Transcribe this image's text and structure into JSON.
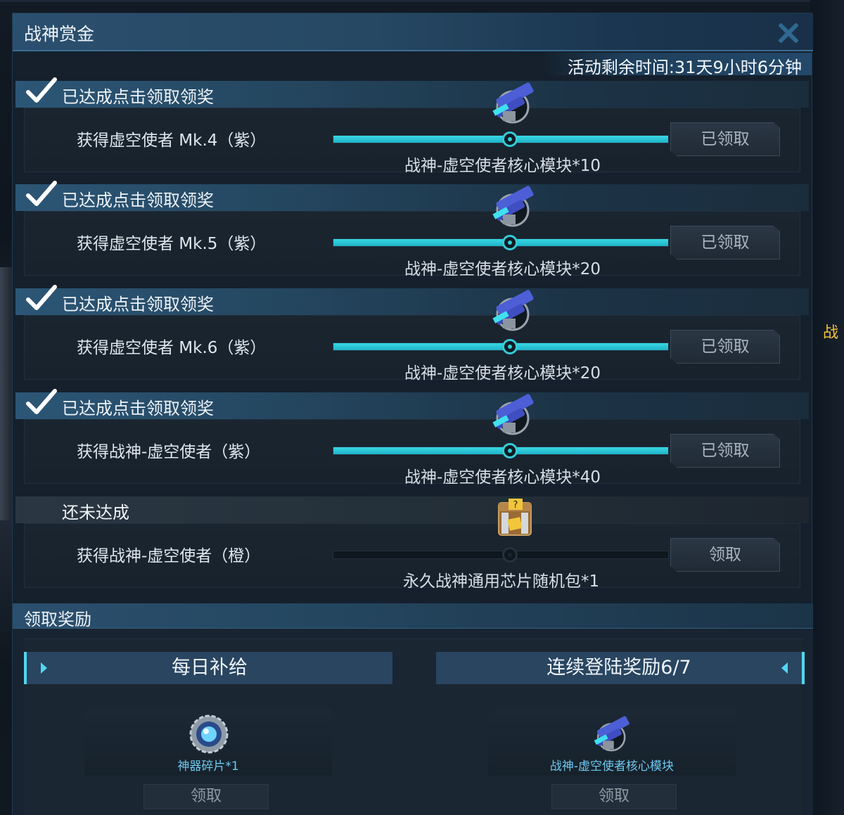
{
  "window": {
    "title": "战神赏金",
    "time_remaining": "活动剩余时间:31天9小时6分钟"
  },
  "rows": [
    {
      "status": "已达成点击领取领奖",
      "label": "获得虚空使者 Mk.4（紫）",
      "reward": "战神-虚空使者核心模块*10",
      "button": "已领取",
      "progress": 1.0,
      "achieved": true,
      "icon": "weapon-core-icon"
    },
    {
      "status": "已达成点击领取领奖",
      "label": "获得虚空使者 Mk.5（紫）",
      "reward": "战神-虚空使者核心模块*20",
      "button": "已领取",
      "progress": 1.0,
      "achieved": true,
      "icon": "weapon-core-icon"
    },
    {
      "status": "已达成点击领取领奖",
      "label": "获得虚空使者 Mk.6（紫）",
      "reward": "战神-虚空使者核心模块*20",
      "button": "已领取",
      "progress": 1.0,
      "achieved": true,
      "icon": "weapon-core-icon"
    },
    {
      "status": "已达成点击领取领奖",
      "label": "获得战神-虚空使者（紫）",
      "reward": "战神-虚空使者核心模块*40",
      "button": "已领取",
      "progress": 1.0,
      "achieved": true,
      "icon": "weapon-core-icon"
    },
    {
      "status": "还未达成",
      "label": "获得战神-虚空使者（橙）",
      "reward": "永久战神通用芯片随机包*1",
      "button": "领取",
      "progress": 0.0,
      "achieved": false,
      "icon": "mystery-box-icon"
    }
  ],
  "bottom": {
    "title": "领取奖励",
    "tab_daily": "每日补给",
    "tab_login": "连续登陆奖励6/7",
    "daily_item": "神器碎片*1",
    "daily_item_icon": "gear-shard-icon",
    "login_item": "战神-虚空使者核心模块",
    "login_item_icon": "weapon-core-icon",
    "claim_label": "领取"
  },
  "background": {
    "side_char": "战"
  },
  "colors": {
    "accent": "#34cbd6",
    "header": "#2b4f6e",
    "reward_text_blue": "#6fc8ef"
  }
}
